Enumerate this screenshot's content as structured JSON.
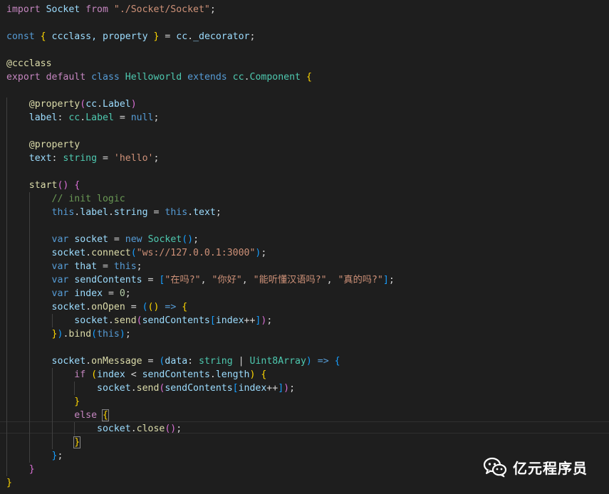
{
  "editor": {
    "lines": [
      [
        {
          "t": "import",
          "c": "ctl"
        },
        {
          "t": " Socket ",
          "c": "var"
        },
        {
          "t": "from",
          "c": "ctl"
        },
        {
          "t": " ",
          "c": "plain"
        },
        {
          "t": "\"./Socket/Socket\"",
          "c": "str"
        },
        {
          "t": ";",
          "c": "plain"
        }
      ],
      [],
      [
        {
          "t": "const",
          "c": "kw"
        },
        {
          "t": " ",
          "c": "plain"
        },
        {
          "t": "{",
          "c": "br1"
        },
        {
          "t": " ccclass, property ",
          "c": "var"
        },
        {
          "t": "}",
          "c": "br1"
        },
        {
          "t": " = ",
          "c": "op"
        },
        {
          "t": "cc",
          "c": "var"
        },
        {
          "t": ".",
          "c": "plain"
        },
        {
          "t": "_decorator",
          "c": "var"
        },
        {
          "t": ";",
          "c": "plain"
        }
      ],
      [],
      [
        {
          "t": "@ccclass",
          "c": "dec"
        }
      ],
      [
        {
          "t": "export",
          "c": "ctl"
        },
        {
          "t": " ",
          "c": "plain"
        },
        {
          "t": "default",
          "c": "ctl"
        },
        {
          "t": " ",
          "c": "plain"
        },
        {
          "t": "class",
          "c": "kw"
        },
        {
          "t": " ",
          "c": "plain"
        },
        {
          "t": "Helloworld",
          "c": "type"
        },
        {
          "t": " ",
          "c": "plain"
        },
        {
          "t": "extends",
          "c": "kw"
        },
        {
          "t": " ",
          "c": "plain"
        },
        {
          "t": "cc",
          "c": "type"
        },
        {
          "t": ".",
          "c": "plain"
        },
        {
          "t": "Component",
          "c": "type"
        },
        {
          "t": " ",
          "c": "plain"
        },
        {
          "t": "{",
          "c": "br1"
        }
      ],
      [],
      [
        {
          "t": "    ",
          "c": "plain"
        },
        {
          "t": "@property",
          "c": "dec"
        },
        {
          "t": "(",
          "c": "br2"
        },
        {
          "t": "cc",
          "c": "var"
        },
        {
          "t": ".",
          "c": "plain"
        },
        {
          "t": "Label",
          "c": "var"
        },
        {
          "t": ")",
          "c": "br2"
        }
      ],
      [
        {
          "t": "    ",
          "c": "plain"
        },
        {
          "t": "label",
          "c": "var"
        },
        {
          "t": ": ",
          "c": "plain"
        },
        {
          "t": "cc",
          "c": "type"
        },
        {
          "t": ".",
          "c": "plain"
        },
        {
          "t": "Label",
          "c": "type"
        },
        {
          "t": " = ",
          "c": "op"
        },
        {
          "t": "null",
          "c": "kw"
        },
        {
          "t": ";",
          "c": "plain"
        }
      ],
      [],
      [
        {
          "t": "    ",
          "c": "plain"
        },
        {
          "t": "@property",
          "c": "dec"
        }
      ],
      [
        {
          "t": "    ",
          "c": "plain"
        },
        {
          "t": "text",
          "c": "var"
        },
        {
          "t": ": ",
          "c": "plain"
        },
        {
          "t": "string",
          "c": "type"
        },
        {
          "t": " = ",
          "c": "op"
        },
        {
          "t": "'hello'",
          "c": "str"
        },
        {
          "t": ";",
          "c": "plain"
        }
      ],
      [],
      [
        {
          "t": "    ",
          "c": "plain"
        },
        {
          "t": "start",
          "c": "fn"
        },
        {
          "t": "()",
          "c": "br2"
        },
        {
          "t": " ",
          "c": "plain"
        },
        {
          "t": "{",
          "c": "br2"
        }
      ],
      [
        {
          "t": "        ",
          "c": "plain"
        },
        {
          "t": "// init logic",
          "c": "cmt"
        }
      ],
      [
        {
          "t": "        ",
          "c": "plain"
        },
        {
          "t": "this",
          "c": "kw"
        },
        {
          "t": ".",
          "c": "plain"
        },
        {
          "t": "label",
          "c": "var"
        },
        {
          "t": ".",
          "c": "plain"
        },
        {
          "t": "string",
          "c": "var"
        },
        {
          "t": " = ",
          "c": "op"
        },
        {
          "t": "this",
          "c": "kw"
        },
        {
          "t": ".",
          "c": "plain"
        },
        {
          "t": "text",
          "c": "var"
        },
        {
          "t": ";",
          "c": "plain"
        }
      ],
      [],
      [
        {
          "t": "        ",
          "c": "plain"
        },
        {
          "t": "var",
          "c": "kw"
        },
        {
          "t": " ",
          "c": "plain"
        },
        {
          "t": "socket",
          "c": "var"
        },
        {
          "t": " = ",
          "c": "op"
        },
        {
          "t": "new",
          "c": "kw"
        },
        {
          "t": " ",
          "c": "plain"
        },
        {
          "t": "Socket",
          "c": "type"
        },
        {
          "t": "()",
          "c": "br3"
        },
        {
          "t": ";",
          "c": "plain"
        }
      ],
      [
        {
          "t": "        ",
          "c": "plain"
        },
        {
          "t": "socket",
          "c": "var"
        },
        {
          "t": ".",
          "c": "plain"
        },
        {
          "t": "connect",
          "c": "fn"
        },
        {
          "t": "(",
          "c": "br3"
        },
        {
          "t": "\"ws://127.0.0.1:3000\"",
          "c": "str"
        },
        {
          "t": ")",
          "c": "br3"
        },
        {
          "t": ";",
          "c": "plain"
        }
      ],
      [
        {
          "t": "        ",
          "c": "plain"
        },
        {
          "t": "var",
          "c": "kw"
        },
        {
          "t": " ",
          "c": "plain"
        },
        {
          "t": "that",
          "c": "var"
        },
        {
          "t": " = ",
          "c": "op"
        },
        {
          "t": "this",
          "c": "kw"
        },
        {
          "t": ";",
          "c": "plain"
        }
      ],
      [
        {
          "t": "        ",
          "c": "plain"
        },
        {
          "t": "var",
          "c": "kw"
        },
        {
          "t": " ",
          "c": "plain"
        },
        {
          "t": "sendContents",
          "c": "var"
        },
        {
          "t": " = ",
          "c": "op"
        },
        {
          "t": "[",
          "c": "br3"
        },
        {
          "t": "\"在吗?\"",
          "c": "str"
        },
        {
          "t": ", ",
          "c": "plain"
        },
        {
          "t": "\"你好\"",
          "c": "str"
        },
        {
          "t": ", ",
          "c": "plain"
        },
        {
          "t": "\"能听懂汉语吗?\"",
          "c": "str"
        },
        {
          "t": ", ",
          "c": "plain"
        },
        {
          "t": "\"真的吗?\"",
          "c": "str"
        },
        {
          "t": "]",
          "c": "br3"
        },
        {
          "t": ";",
          "c": "plain"
        }
      ],
      [
        {
          "t": "        ",
          "c": "plain"
        },
        {
          "t": "var",
          "c": "kw"
        },
        {
          "t": " ",
          "c": "plain"
        },
        {
          "t": "index",
          "c": "var"
        },
        {
          "t": " = ",
          "c": "op"
        },
        {
          "t": "0",
          "c": "num"
        },
        {
          "t": ";",
          "c": "plain"
        }
      ],
      [
        {
          "t": "        ",
          "c": "plain"
        },
        {
          "t": "socket",
          "c": "var"
        },
        {
          "t": ".",
          "c": "plain"
        },
        {
          "t": "onOpen",
          "c": "fn"
        },
        {
          "t": " = ",
          "c": "op"
        },
        {
          "t": "(",
          "c": "br3"
        },
        {
          "t": "()",
          "c": "br1"
        },
        {
          "t": " => ",
          "c": "kw"
        },
        {
          "t": "{",
          "c": "br1"
        }
      ],
      [
        {
          "t": "            ",
          "c": "plain"
        },
        {
          "t": "socket",
          "c": "var"
        },
        {
          "t": ".",
          "c": "plain"
        },
        {
          "t": "send",
          "c": "fn"
        },
        {
          "t": "(",
          "c": "br2"
        },
        {
          "t": "sendContents",
          "c": "var"
        },
        {
          "t": "[",
          "c": "br3"
        },
        {
          "t": "index",
          "c": "var"
        },
        {
          "t": "++",
          "c": "op"
        },
        {
          "t": "]",
          "c": "br3"
        },
        {
          "t": ")",
          "c": "br2"
        },
        {
          "t": ";",
          "c": "plain"
        }
      ],
      [
        {
          "t": "        ",
          "c": "plain"
        },
        {
          "t": "}",
          "c": "br1"
        },
        {
          "t": ")",
          "c": "br3"
        },
        {
          "t": ".",
          "c": "plain"
        },
        {
          "t": "bind",
          "c": "fn"
        },
        {
          "t": "(",
          "c": "br3"
        },
        {
          "t": "this",
          "c": "kw"
        },
        {
          "t": ")",
          "c": "br3"
        },
        {
          "t": ";",
          "c": "plain"
        }
      ],
      [],
      [
        {
          "t": "        ",
          "c": "plain"
        },
        {
          "t": "socket",
          "c": "var"
        },
        {
          "t": ".",
          "c": "plain"
        },
        {
          "t": "onMessage",
          "c": "fn"
        },
        {
          "t": " = ",
          "c": "op"
        },
        {
          "t": "(",
          "c": "br3"
        },
        {
          "t": "data",
          "c": "var"
        },
        {
          "t": ": ",
          "c": "plain"
        },
        {
          "t": "string",
          "c": "type"
        },
        {
          "t": " | ",
          "c": "op"
        },
        {
          "t": "Uint8Array",
          "c": "type"
        },
        {
          "t": ")",
          "c": "br3"
        },
        {
          "t": " => ",
          "c": "kw"
        },
        {
          "t": "{",
          "c": "br3"
        }
      ],
      [
        {
          "t": "            ",
          "c": "plain"
        },
        {
          "t": "if",
          "c": "ctl"
        },
        {
          "t": " ",
          "c": "plain"
        },
        {
          "t": "(",
          "c": "br1"
        },
        {
          "t": "index",
          "c": "var"
        },
        {
          "t": " < ",
          "c": "op"
        },
        {
          "t": "sendContents",
          "c": "var"
        },
        {
          "t": ".",
          "c": "plain"
        },
        {
          "t": "length",
          "c": "var"
        },
        {
          "t": ")",
          "c": "br1"
        },
        {
          "t": " ",
          "c": "plain"
        },
        {
          "t": "{",
          "c": "br1"
        }
      ],
      [
        {
          "t": "                ",
          "c": "plain"
        },
        {
          "t": "socket",
          "c": "var"
        },
        {
          "t": ".",
          "c": "plain"
        },
        {
          "t": "send",
          "c": "fn"
        },
        {
          "t": "(",
          "c": "br2"
        },
        {
          "t": "sendContents",
          "c": "var"
        },
        {
          "t": "[",
          "c": "br3"
        },
        {
          "t": "index",
          "c": "var"
        },
        {
          "t": "++",
          "c": "op"
        },
        {
          "t": "]",
          "c": "br3"
        },
        {
          "t": ")",
          "c": "br2"
        },
        {
          "t": ";",
          "c": "plain"
        }
      ],
      [
        {
          "t": "            ",
          "c": "plain"
        },
        {
          "t": "}",
          "c": "br1"
        }
      ],
      [
        {
          "t": "            ",
          "c": "plain"
        },
        {
          "t": "else",
          "c": "ctl"
        },
        {
          "t": " ",
          "c": "plain"
        },
        {
          "t": "{",
          "c": "br1",
          "m": true
        }
      ],
      [
        {
          "t": "                ",
          "c": "plain"
        },
        {
          "t": "socket",
          "c": "var"
        },
        {
          "t": ".",
          "c": "plain"
        },
        {
          "t": "close",
          "c": "fn"
        },
        {
          "t": "()",
          "c": "br2"
        },
        {
          "t": ";",
          "c": "plain"
        }
      ],
      [
        {
          "t": "            ",
          "c": "plain"
        },
        {
          "t": "}",
          "c": "br1",
          "m": true
        }
      ],
      [
        {
          "t": "        ",
          "c": "plain"
        },
        {
          "t": "}",
          "c": "br3"
        },
        {
          "t": ";",
          "c": "plain"
        }
      ],
      [
        {
          "t": "    ",
          "c": "plain"
        },
        {
          "t": "}",
          "c": "br2"
        }
      ],
      [
        {
          "t": "}",
          "c": "br1"
        }
      ]
    ]
  },
  "watermark": {
    "icon": "wechat-icon",
    "text": "亿元程序员"
  },
  "colors": {
    "background": "#1e1e1e",
    "keyword": "#569cd6",
    "control": "#c586c0",
    "variable": "#9cdcfe",
    "function": "#dcdcaa",
    "type": "#4ec9b0",
    "string": "#ce9178",
    "number": "#b5cea8",
    "comment": "#6a9955"
  }
}
